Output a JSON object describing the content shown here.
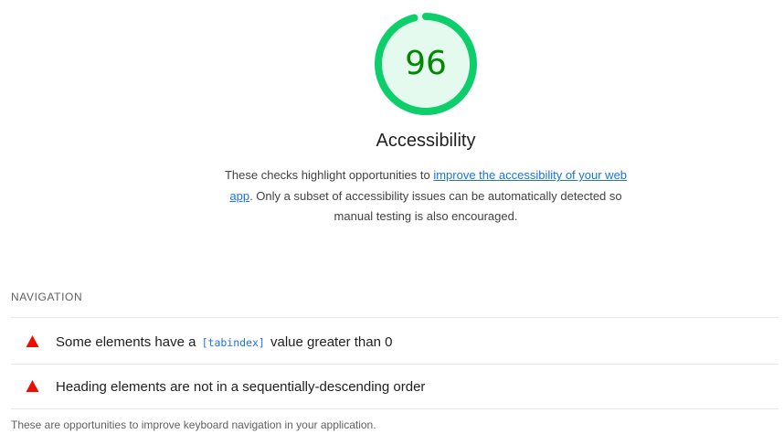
{
  "score": {
    "value": "96",
    "label": "Accessibility",
    "fraction": 0.96,
    "color": "#0cce6b",
    "bg_color": "#e5faef",
    "text_color": "#008800"
  },
  "description": {
    "before": "These checks highlight opportunities to ",
    "link_text": "improve the accessibility of your web app",
    "after": ". Only a subset of accessibility issues can be automatically detected so manual testing is also encouraged."
  },
  "group": {
    "title": "NAVIGATION",
    "footer": "These are opportunities to improve keyboard navigation in your application.",
    "audits": [
      {
        "icon": "fail-triangle-icon",
        "before": "Some elements have a ",
        "code": "[tabindex]",
        "after": " value greater than 0"
      },
      {
        "icon": "fail-triangle-icon",
        "before": "Heading elements are not in a sequentially-descending order",
        "code": "",
        "after": ""
      }
    ]
  },
  "colors": {
    "fail": "#eb0f00",
    "link": "#1a73e8"
  }
}
